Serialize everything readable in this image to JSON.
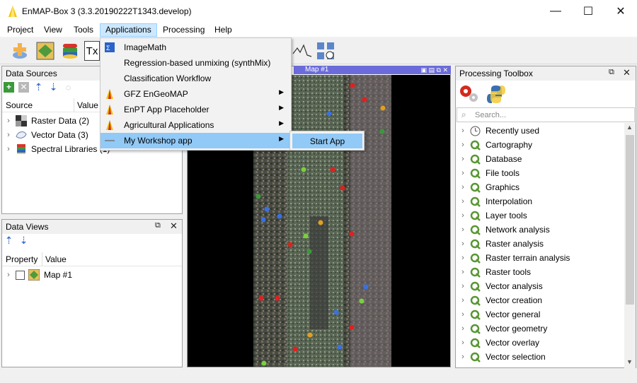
{
  "window": {
    "title": "EnMAP-Box 3 (3.3.20190222T1343.develop)",
    "minimize": "—",
    "maximize": "☐",
    "close": "✕"
  },
  "menubar": [
    "Project",
    "View",
    "Tools",
    "Applications",
    "Processing",
    "Help"
  ],
  "toolbar": {
    "text_tool_label": "Tx"
  },
  "applications_menu": {
    "items": [
      {
        "label": "ImageMath",
        "icon": "image-math-icon",
        "has_submenu": false
      },
      {
        "label": "Regression-based unmixing (synthMix)",
        "icon": "",
        "has_submenu": false
      },
      {
        "label": "Classification Workflow",
        "icon": "",
        "has_submenu": false
      },
      {
        "label": "GFZ EnGeoMAP",
        "icon": "enmap-logo-icon",
        "has_submenu": true
      },
      {
        "label": "EnPT App Placeholder",
        "icon": "enmap-logo-icon",
        "has_submenu": true
      },
      {
        "label": "Agricultural Applications",
        "icon": "enmap-logo-icon",
        "has_submenu": true
      },
      {
        "label": "My Workshop app",
        "icon": "line-icon",
        "has_submenu": true,
        "highlighted": true
      }
    ],
    "submenu": {
      "label": "Start App"
    }
  },
  "data_sources": {
    "title": "Data Sources",
    "columns": [
      "Source",
      "Value"
    ],
    "items": [
      {
        "label": "Raster Data (2)",
        "icon": "raster-icon"
      },
      {
        "label": "Vector Data (3)",
        "icon": "vector-icon"
      },
      {
        "label": "Spectral Libraries (1)",
        "icon": "speclib-icon"
      }
    ]
  },
  "data_views": {
    "title": "Data Views",
    "columns": [
      "Property",
      "Value"
    ],
    "items": [
      {
        "label": "Map #1",
        "icon": "map-icon"
      }
    ]
  },
  "map": {
    "title": "Map #1"
  },
  "processing_toolbox": {
    "title": "Processing Toolbox",
    "search_placeholder": "Search...",
    "items": [
      "Recently used",
      "Cartography",
      "Database",
      "File tools",
      "Graphics",
      "Interpolation",
      "Layer tools",
      "Network analysis",
      "Raster analysis",
      "Raster terrain analysis",
      "Raster tools",
      "Vector analysis",
      "Vector creation",
      "Vector general",
      "Vector geometry",
      "Vector overlay",
      "Vector selection"
    ]
  },
  "colors": {
    "menu_highlight": "#91c9f7",
    "active_menu": "#cce8ff",
    "map_title_bar": "#6b6bdb",
    "qgis_green": "#589632"
  }
}
